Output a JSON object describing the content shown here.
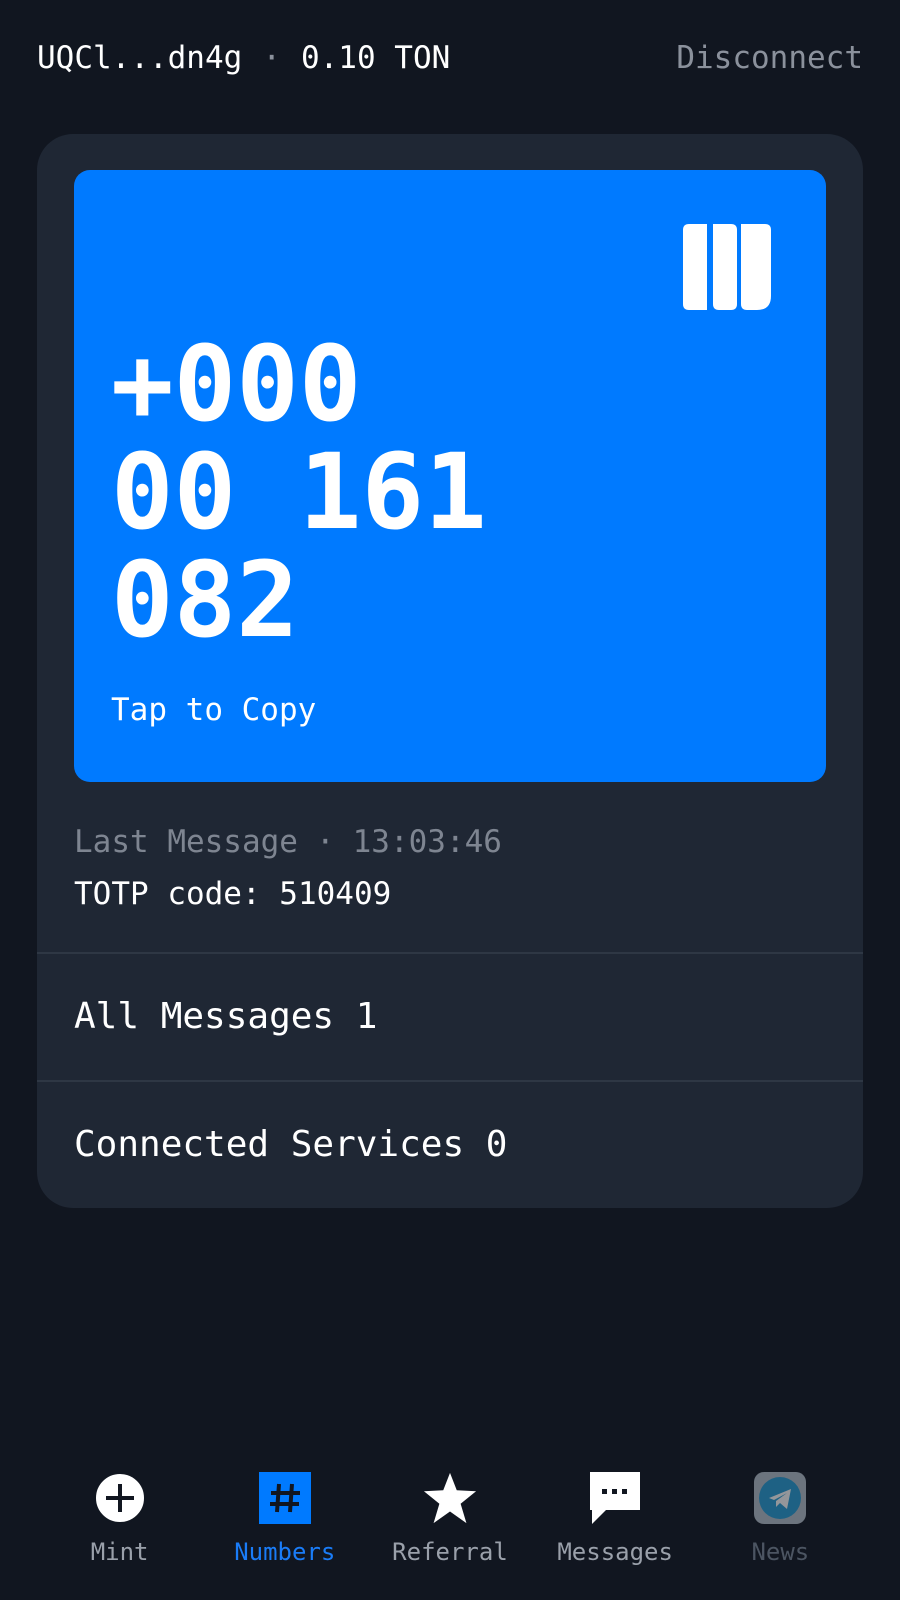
{
  "header": {
    "wallet_address": "UQCl...dn4g",
    "separator": "·",
    "balance": "0.10 TON",
    "disconnect_label": "Disconnect"
  },
  "number_card": {
    "number": "+000\n00 161\n082",
    "copy_hint": "Tap to Copy",
    "logo_icon": "fragment-logo-icon",
    "background": "#007aff"
  },
  "last_message": {
    "label": "Last Message",
    "separator": "·",
    "time": "13:03:46",
    "text": "TOTP code: 510409"
  },
  "rows": [
    {
      "label": "All Messages 1"
    },
    {
      "label": "Connected Services 0"
    }
  ],
  "bottom_nav": [
    {
      "label": "Mint",
      "icon": "plus-circle-icon"
    },
    {
      "label": "Numbers",
      "icon": "hash-icon",
      "active": true
    },
    {
      "label": "Referral",
      "icon": "star-icon"
    },
    {
      "label": "Messages",
      "icon": "chat-bubble-icon"
    },
    {
      "label": "News",
      "icon": "telegram-icon"
    }
  ],
  "colors": {
    "background": "#111620",
    "panel": "#1f2734",
    "accent": "#007aff",
    "muted_text": "#8b919c"
  }
}
